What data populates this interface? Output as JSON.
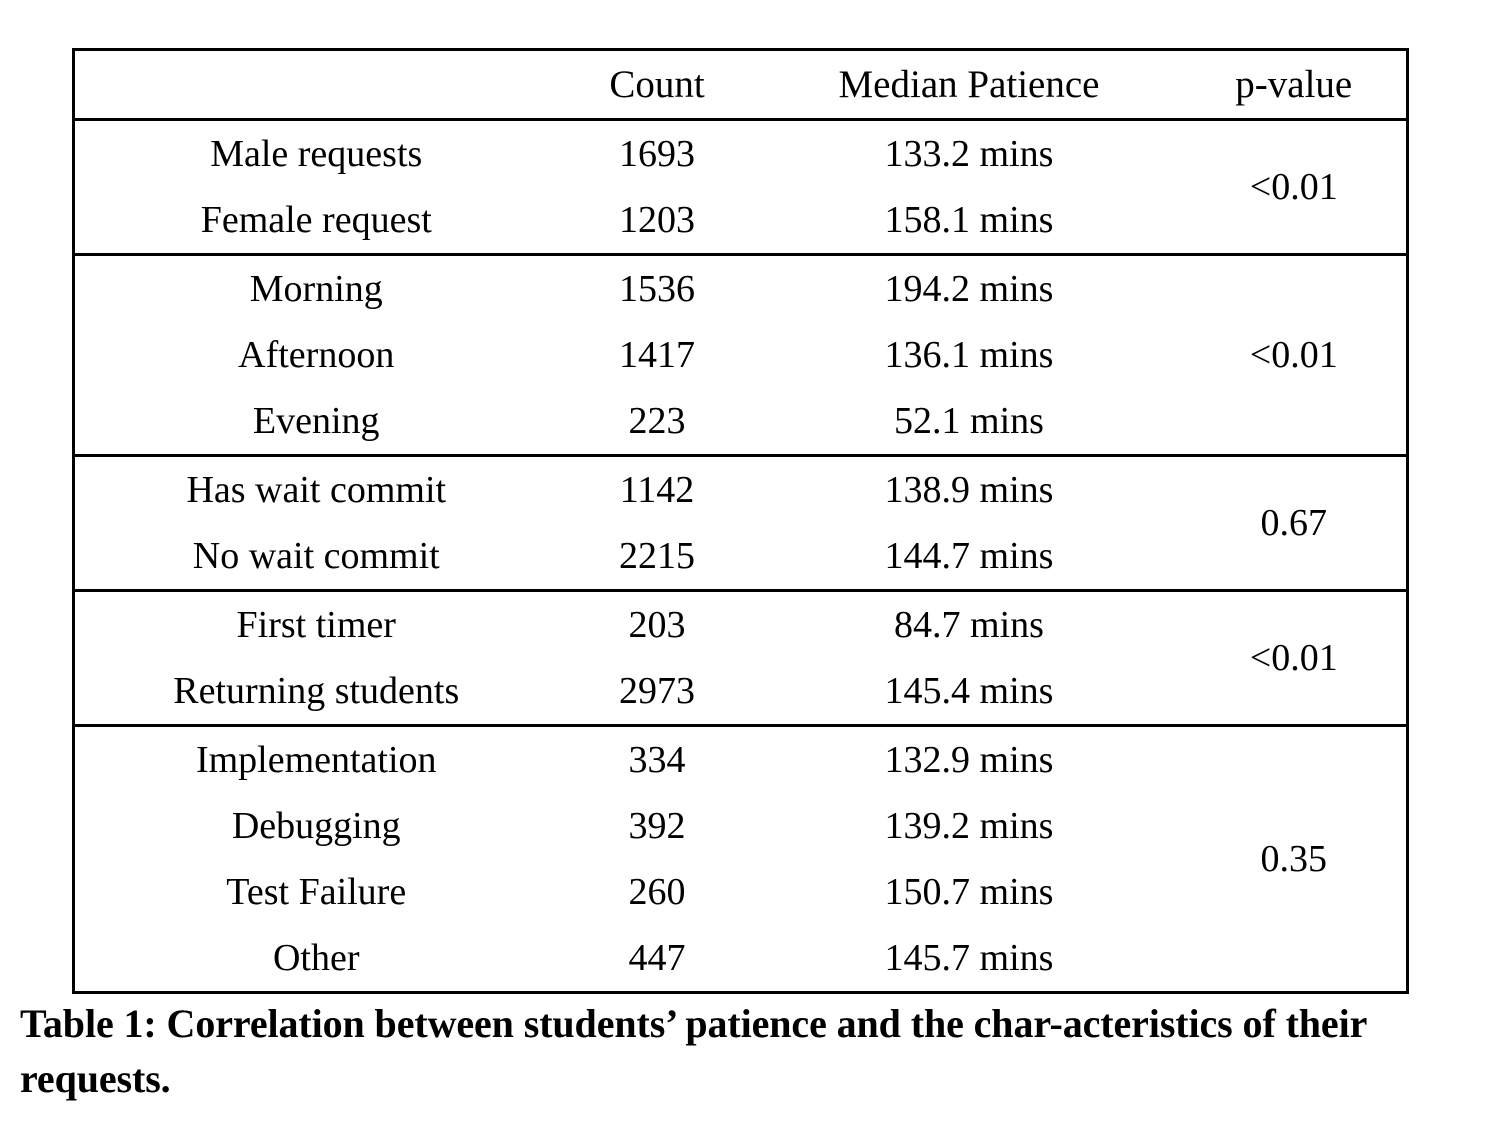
{
  "table": {
    "columns": [
      {
        "key": "label",
        "header": ""
      },
      {
        "key": "count",
        "header": "Count"
      },
      {
        "key": "median",
        "header": "Median Patience"
      },
      {
        "key": "pvalue",
        "header": "p-value"
      }
    ],
    "groups": [
      {
        "name": "gender",
        "pvalue": "<0.01",
        "rows": [
          {
            "label": "Male requests",
            "count": "1693",
            "median": "133.2 mins"
          },
          {
            "label": "Female request",
            "count": "1203",
            "median": "158.1 mins"
          }
        ]
      },
      {
        "name": "time-of-day",
        "pvalue": "<0.01",
        "rows": [
          {
            "label": "Morning",
            "count": "1536",
            "median": "194.2 mins"
          },
          {
            "label": "Afternoon",
            "count": "1417",
            "median": "136.1 mins"
          },
          {
            "label": "Evening",
            "count": "223",
            "median": "52.1 mins"
          }
        ]
      },
      {
        "name": "wait-commit",
        "pvalue": "0.67",
        "rows": [
          {
            "label": "Has wait commit",
            "count": "1142",
            "median": "138.9 mins"
          },
          {
            "label": "No wait commit",
            "count": "2215",
            "median": "144.7 mins"
          }
        ]
      },
      {
        "name": "experience",
        "pvalue": "<0.01",
        "rows": [
          {
            "label": "First timer",
            "count": "203",
            "median": "84.7 mins"
          },
          {
            "label": "Returning students",
            "count": "2973",
            "median": "145.4 mins"
          }
        ]
      },
      {
        "name": "request-type",
        "pvalue": "0.35",
        "rows": [
          {
            "label": "Implementation",
            "count": "334",
            "median": "132.9 mins"
          },
          {
            "label": "Debugging",
            "count": "392",
            "median": "139.2 mins"
          },
          {
            "label": "Test Failure",
            "count": "260",
            "median": "150.7 mins"
          },
          {
            "label": "Other",
            "count": "447",
            "median": "145.7 mins"
          }
        ]
      }
    ]
  },
  "caption": {
    "text": "Table 1: Correlation between students’ patience and the char-acteristics of their requests."
  },
  "chart_data": {
    "type": "table",
    "title": "Correlation between students’ patience and the characteristics of their requests.",
    "columns": [
      "",
      "Count",
      "Median Patience",
      "p-value"
    ],
    "rows": [
      [
        "Male requests",
        1693,
        133.2,
        "<0.01"
      ],
      [
        "Female request",
        1203,
        158.1,
        "<0.01"
      ],
      [
        "Morning",
        1536,
        194.2,
        "<0.01"
      ],
      [
        "Afternoon",
        1417,
        136.1,
        "<0.01"
      ],
      [
        "Evening",
        223,
        52.1,
        "<0.01"
      ],
      [
        "Has wait commit",
        1142,
        138.9,
        "0.67"
      ],
      [
        "No wait commit",
        2215,
        144.7,
        "0.67"
      ],
      [
        "First timer",
        203,
        84.7,
        "<0.01"
      ],
      [
        "Returning students",
        2973,
        145.4,
        "<0.01"
      ],
      [
        "Implementation",
        334,
        132.9,
        "0.35"
      ],
      [
        "Debugging",
        392,
        139.2,
        "0.35"
      ],
      [
        "Test Failure",
        260,
        150.7,
        "0.35"
      ],
      [
        "Other",
        447,
        145.7,
        "0.35"
      ]
    ],
    "units": {
      "median": "mins"
    }
  }
}
